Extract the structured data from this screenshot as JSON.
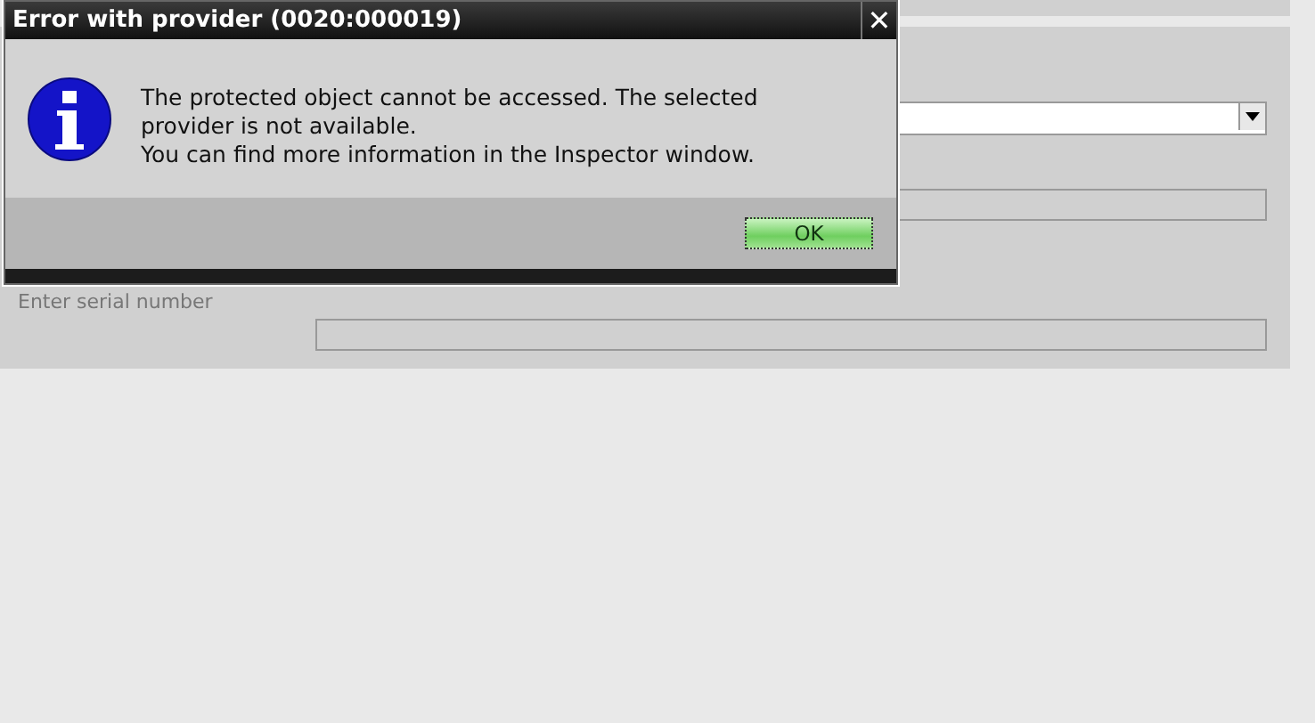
{
  "dialog": {
    "title": "Error with provider (0020:000019)",
    "close": "✕",
    "message_lines": [
      "The protected object cannot be accessed. The selected",
      "provider is not available.",
      "You can find more information in the Inspector window."
    ],
    "buttons": [
      "OK"
    ]
  },
  "form": {
    "serial_label": "Enter serial number"
  }
}
